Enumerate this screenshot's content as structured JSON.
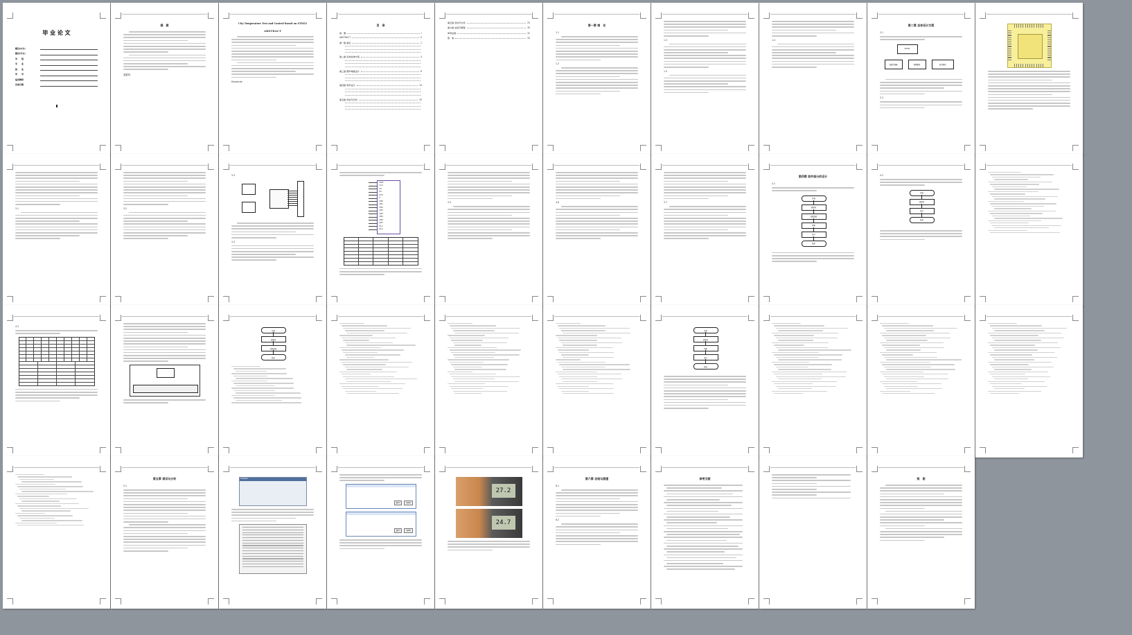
{
  "document": {
    "cover": {
      "title": "毕 业 论 文",
      "fields": [
        {
          "key": "题目(中文)"
        },
        {
          "key": "题目(外文)"
        },
        {
          "key": "学　　院"
        },
        {
          "key": "专　　业"
        },
        {
          "key": "姓　　名"
        },
        {
          "key": "学　　号"
        },
        {
          "key": "指导教师"
        },
        {
          "key": "完成日期"
        }
      ]
    },
    "abstract_cn": {
      "heading": "摘　要",
      "keywords_label": "关键词："
    },
    "abstract_en": {
      "title": "City Temperature Test and Control Based on STM32",
      "heading": "ABSTRACT",
      "keywords_label": "Keywords:"
    },
    "toc": {
      "heading": "目　录",
      "entries": [
        {
          "label": "摘　要",
          "page": "I"
        },
        {
          "label": "ABSTRACT",
          "page": "II"
        },
        {
          "label": "第一章 绪论",
          "page": "1"
        },
        {
          "label": "第二章 系统总体方案",
          "page": "4"
        },
        {
          "label": "第三章 硬件电路设计",
          "page": "6"
        },
        {
          "label": "第四章 软件设计",
          "page": "14"
        },
        {
          "label": "第五章 测试与分析",
          "page": "25"
        }
      ],
      "entries_cont": [
        {
          "label": "第五章 调试与分析",
          "page": "25"
        },
        {
          "label": "第六章 总结与展望",
          "page": "30"
        },
        {
          "label": "参考文献",
          "page": "31"
        },
        {
          "label": "致　谢",
          "page": "33"
        }
      ]
    },
    "chapters": {
      "ch1": "第一章 绪　论",
      "ch2": "第二章 总体设计方案",
      "ch4": "第四章 软件部分的设计",
      "ch5": "第五章 调试与分析",
      "ch6": "第六章 总结与展望",
      "refs": "参考文献",
      "thanks": "致　谢"
    },
    "block_diagram": {
      "left1": "温度传感器",
      "left2": "按键模块",
      "center": "STM32",
      "right": "显示模块"
    },
    "flowchart": {
      "start": "开始",
      "init": "初始化",
      "read": "读取温度",
      "judge": "判断",
      "display": "显示",
      "end": "结束"
    },
    "chip_labels": [
      "GND",
      "VCC",
      "V0",
      "RS",
      "R/W",
      "E",
      "DB0",
      "DB1",
      "DB2",
      "DB3",
      "DB4",
      "DB5",
      "DB6",
      "DB7",
      "BLA",
      "BLK"
    ],
    "photo_readouts": [
      "27.2",
      "24.7"
    ],
    "dialog": {
      "title": "Notepad",
      "button_yes": "是(Y)",
      "button_no": "否(N)"
    }
  }
}
